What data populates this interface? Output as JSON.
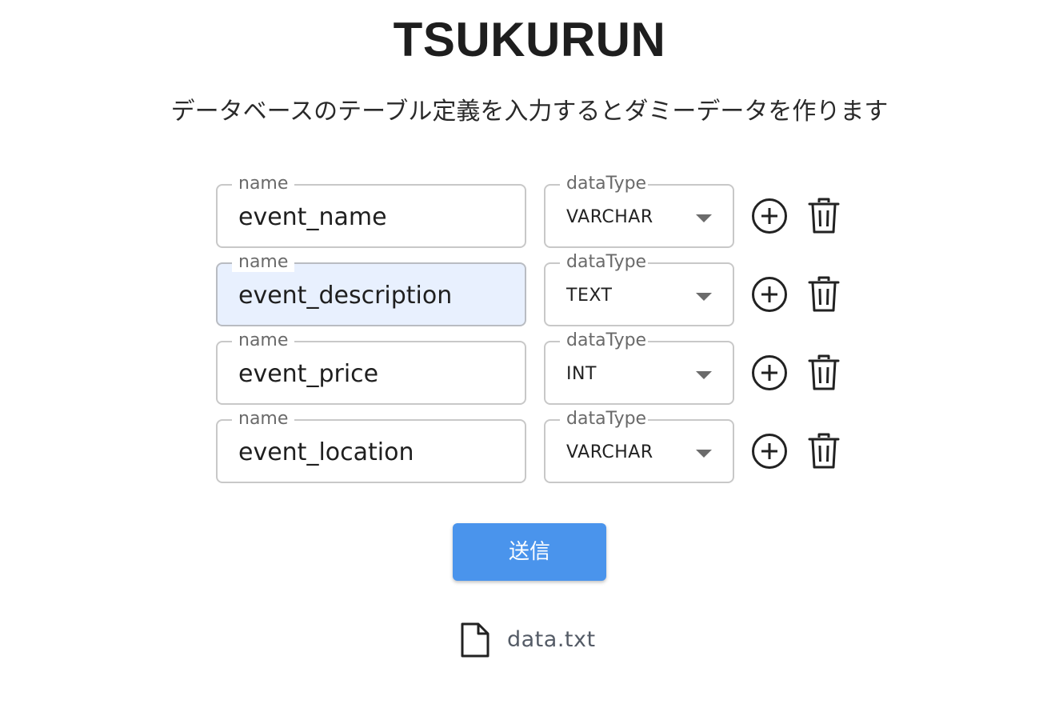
{
  "header": {
    "title": "TSUKURUN",
    "subtitle": "データベースのテーブル定義を入力するとダミーデータを作ります"
  },
  "columns": [
    {
      "name_label": "name",
      "name_value": "event_name",
      "type_label": "dataType",
      "type_value": "VARCHAR",
      "autofilled": false
    },
    {
      "name_label": "name",
      "name_value": "event_description",
      "type_label": "dataType",
      "type_value": "TEXT",
      "autofilled": true
    },
    {
      "name_label": "name",
      "name_value": "event_price",
      "type_label": "dataType",
      "type_value": "INT",
      "autofilled": false
    },
    {
      "name_label": "name",
      "name_value": "event_location",
      "type_label": "dataType",
      "type_value": "VARCHAR",
      "autofilled": false
    }
  ],
  "row_actions": {
    "add_icon": "add-circle-icon",
    "delete_icon": "trash-icon"
  },
  "submit": {
    "label": "送信"
  },
  "output": {
    "file_icon": "file-icon",
    "file_name": "data.txt"
  },
  "colors": {
    "button": "#4a94ec",
    "autofill_background": "#e8f0fe",
    "file_text": "#545b66"
  }
}
